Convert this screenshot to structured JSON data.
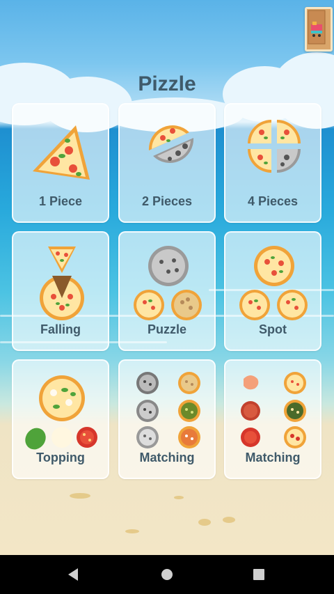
{
  "app": {
    "title": "Pizzle"
  },
  "corner_button": {
    "icon": "train-box-icon"
  },
  "modes": [
    {
      "label": "1 Piece",
      "icon": "pizza-slice-icon"
    },
    {
      "label": "2 Pieces",
      "icon": "pizza-halves-icon"
    },
    {
      "label": "4 Pieces",
      "icon": "pizza-quarters-icon"
    },
    {
      "label": "Falling",
      "icon": "falling-slice-icon"
    },
    {
      "label": "Puzzle",
      "icon": "pizza-puzzle-icon"
    },
    {
      "label": "Spot",
      "icon": "pizza-spot-icon"
    },
    {
      "label": "Topping",
      "icon": "pizza-topping-icon"
    },
    {
      "label": "Matching",
      "icon": "pizza-matching-icon"
    },
    {
      "label": "Matching",
      "icon": "topping-matching-icon"
    }
  ],
  "navbar": {
    "back": "back-icon",
    "home": "home-icon",
    "recents": "recents-icon"
  },
  "colors": {
    "crust": "#f0a339",
    "sauce": "#e8503a",
    "cheese": "#ffe6a3",
    "label": "#3f5a6a"
  }
}
